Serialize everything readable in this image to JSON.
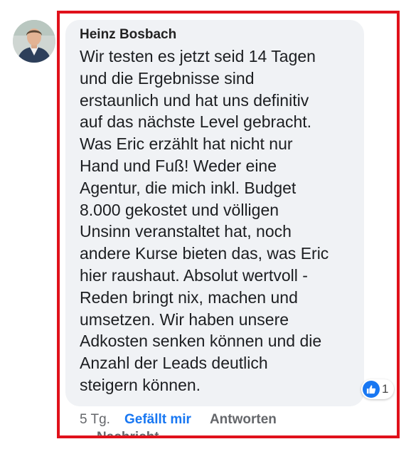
{
  "comment": {
    "author": "Heinz Bosbach",
    "lines": [
      "Wir testen es jetzt seid 14 Tagen",
      "und die Ergebnisse sind",
      "erstaunlich und hat uns definitiv",
      "auf das nächste Level gebracht.",
      "Was Eric erzählt hat nicht nur",
      "Hand und Fuß! Weder eine",
      "Agentur, die mich inkl. Budget",
      "8.000 gekostet und völligen",
      "Unsinn veranstaltet hat, noch",
      "andere Kurse bieten das, was Eric",
      "hier raushaut. Absolut wertvoll -",
      "Reden bringt nix, machen und",
      "umsetzen. Wir haben unsere",
      "Adkosten senken können und die",
      "Anzahl der Leads deutlich",
      "steigern können."
    ],
    "reaction": {
      "icon": "thumbs-up-icon",
      "count": "1"
    },
    "time": "5 Tg.",
    "like_label": "Gefällt mir",
    "reply_label": "Antworten",
    "cutoff_text": "Nachricht"
  },
  "colors": {
    "highlight_frame": "#e0111b",
    "bubble": "#f0f2f5",
    "link_blue": "#1877f2",
    "muted": "#65676b"
  }
}
